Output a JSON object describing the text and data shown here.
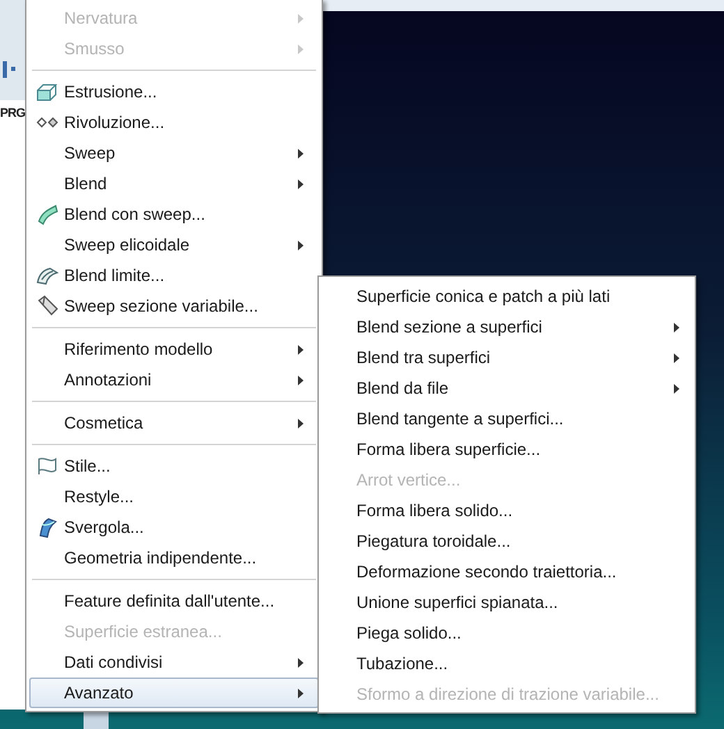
{
  "toolbar": {
    "tab_label": "PRG"
  },
  "menu": {
    "items": [
      {
        "kind": "item",
        "label": "Nervatura",
        "disabled": true,
        "submenu": true,
        "icon": false,
        "selected": false
      },
      {
        "kind": "item",
        "label": "Smusso",
        "disabled": true,
        "submenu": true,
        "icon": false,
        "selected": false
      },
      {
        "kind": "separator"
      },
      {
        "kind": "item",
        "label": "Estrusione...",
        "disabled": false,
        "submenu": false,
        "icon": true,
        "selected": false
      },
      {
        "kind": "item",
        "label": "Rivoluzione...",
        "disabled": false,
        "submenu": false,
        "icon": true,
        "selected": false
      },
      {
        "kind": "item",
        "label": "Sweep",
        "disabled": false,
        "submenu": true,
        "icon": false,
        "selected": false
      },
      {
        "kind": "item",
        "label": "Blend",
        "disabled": false,
        "submenu": true,
        "icon": false,
        "selected": false
      },
      {
        "kind": "item",
        "label": "Blend con sweep...",
        "disabled": false,
        "submenu": false,
        "icon": true,
        "selected": false
      },
      {
        "kind": "item",
        "label": "Sweep elicoidale",
        "disabled": false,
        "submenu": true,
        "icon": false,
        "selected": false
      },
      {
        "kind": "item",
        "label": "Blend limite...",
        "disabled": false,
        "submenu": false,
        "icon": true,
        "selected": false
      },
      {
        "kind": "item",
        "label": "Sweep sezione variabile...",
        "disabled": false,
        "submenu": false,
        "icon": true,
        "selected": false
      },
      {
        "kind": "separator"
      },
      {
        "kind": "item",
        "label": "Riferimento modello",
        "disabled": false,
        "submenu": true,
        "icon": false,
        "selected": false
      },
      {
        "kind": "item",
        "label": "Annotazioni",
        "disabled": false,
        "submenu": true,
        "icon": false,
        "selected": false
      },
      {
        "kind": "separator"
      },
      {
        "kind": "item",
        "label": "Cosmetica",
        "disabled": false,
        "submenu": true,
        "icon": false,
        "selected": false
      },
      {
        "kind": "separator"
      },
      {
        "kind": "item",
        "label": "Stile...",
        "disabled": false,
        "submenu": false,
        "icon": true,
        "selected": false
      },
      {
        "kind": "item",
        "label": "Restyle...",
        "disabled": false,
        "submenu": false,
        "icon": false,
        "selected": false
      },
      {
        "kind": "item",
        "label": "Svergola...",
        "disabled": false,
        "submenu": false,
        "icon": true,
        "selected": false
      },
      {
        "kind": "item",
        "label": "Geometria indipendente...",
        "disabled": false,
        "submenu": false,
        "icon": false,
        "selected": false
      },
      {
        "kind": "separator"
      },
      {
        "kind": "item",
        "label": "Feature definita dall'utente...",
        "disabled": false,
        "submenu": false,
        "icon": false,
        "selected": false
      },
      {
        "kind": "item",
        "label": "Superficie estranea...",
        "disabled": true,
        "submenu": false,
        "icon": false,
        "selected": false
      },
      {
        "kind": "item",
        "label": "Dati condivisi",
        "disabled": false,
        "submenu": true,
        "icon": false,
        "selected": false
      },
      {
        "kind": "item",
        "label": "Avanzato",
        "disabled": false,
        "submenu": true,
        "icon": false,
        "selected": true
      }
    ]
  },
  "submenu": {
    "items": [
      {
        "label": "Superficie conica e patch a più lati",
        "disabled": false,
        "submenu": false
      },
      {
        "label": "Blend sezione a superfici",
        "disabled": false,
        "submenu": true
      },
      {
        "label": "Blend tra superfici",
        "disabled": false,
        "submenu": true
      },
      {
        "label": "Blend da file",
        "disabled": false,
        "submenu": true
      },
      {
        "label": "Blend tangente a superfici...",
        "disabled": false,
        "submenu": false
      },
      {
        "label": "Forma libera superficie...",
        "disabled": false,
        "submenu": false
      },
      {
        "label": "Arrot vertice...",
        "disabled": true,
        "submenu": false
      },
      {
        "label": "Forma libera solido...",
        "disabled": false,
        "submenu": false
      },
      {
        "label": "Piegatura toroidale...",
        "disabled": false,
        "submenu": false
      },
      {
        "label": "Deformazione secondo traiettoria...",
        "disabled": false,
        "submenu": false
      },
      {
        "label": "Unione superfici spianata...",
        "disabled": false,
        "submenu": false
      },
      {
        "label": "Piega solido...",
        "disabled": false,
        "submenu": false
      },
      {
        "label": "Tubazione...",
        "disabled": false,
        "submenu": false
      },
      {
        "label": "Sformo a direzione di trazione variabile...",
        "disabled": true,
        "submenu": false
      }
    ]
  }
}
